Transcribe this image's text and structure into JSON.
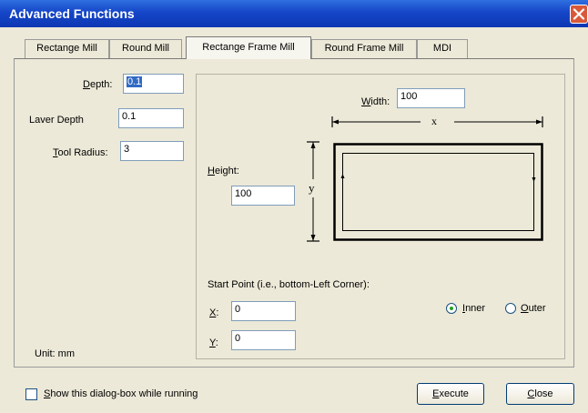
{
  "window": {
    "title": "Advanced Functions"
  },
  "tabs": [
    {
      "label": "Rectange Mill"
    },
    {
      "label": "Round Mill"
    },
    {
      "label": "Rectange Frame Mill"
    },
    {
      "label": "Round Frame Mill"
    },
    {
      "label": "MDI"
    }
  ],
  "active_tab": "Rectange Frame Mill",
  "left": {
    "depth_label_pre": "",
    "depth_label_u": "D",
    "depth_label_post": "epth:",
    "depth_value": "0.1",
    "layer_depth_label": "Laver Depth",
    "layer_depth_value": "0.1",
    "tool_label_u": "T",
    "tool_label_post": "ool Radius:",
    "tool_radius_value": "3",
    "unit_label": "Unit: mm"
  },
  "frame": {
    "width_label_u": "W",
    "width_label_post": "idth:",
    "width_value": "100",
    "x_marker": "x",
    "height_label_u": "H",
    "height_label_post": "eight:",
    "height_value": "100",
    "y_marker": "y",
    "start_point_label": "Start Point (i.e., bottom-Left Corner):",
    "x_label_u": "X",
    "x_label_post": ":",
    "x_value": "0",
    "y_label_u": "Y",
    "y_label_post": ":",
    "y_value": "0",
    "inner_label_u": "I",
    "inner_label_post": "nner",
    "outer_label_u": "O",
    "outer_label_post": "uter",
    "selected_mode": "Inner"
  },
  "footer": {
    "show_label_u": "S",
    "show_label_post": "how this dialog-box while running",
    "show_checked": false,
    "execute_u": "E",
    "execute_post": "xecute",
    "close_u": "C",
    "close_post": "lose"
  },
  "colors": {
    "title_bar": "#0d37b3",
    "window_bg": "#ece9d8",
    "selection": "#316ac5",
    "close_button": "#d8593a"
  }
}
